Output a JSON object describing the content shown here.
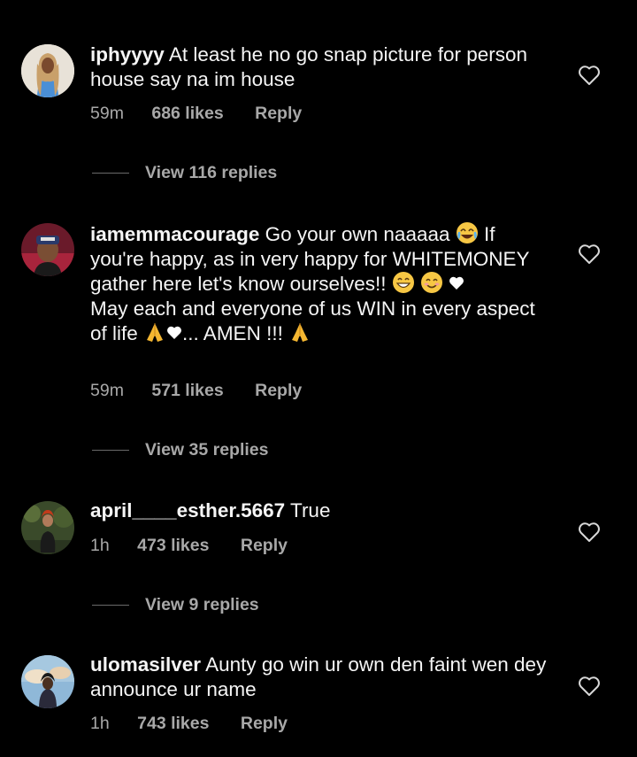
{
  "comments": [
    {
      "username": "iphyyyy",
      "text_parts": [
        "At least he no go snap picture for person house say na im house"
      ],
      "time": "59m",
      "likes": "686 likes",
      "reply": "Reply",
      "view_replies": "View 116 replies"
    },
    {
      "username": "iamemmacourage",
      "text_parts": [
        "Go your own naaaaa",
        "If you're happy, as in very happy for WHITEMONEY gather here let's know ourselves!!",
        "May each and everyone of us WIN in every aspect of life",
        "... AMEN !!!"
      ],
      "time": "59m",
      "likes": "571 likes",
      "reply": "Reply",
      "view_replies": "View 35 replies"
    },
    {
      "username": "april____esther.5667",
      "text_parts": [
        "True"
      ],
      "time": "1h",
      "likes": "473 likes",
      "reply": "Reply",
      "view_replies": "View 9 replies"
    },
    {
      "username": "ulomasilver",
      "text_parts": [
        "Aunty go win ur own den faint wen dey announce ur name"
      ],
      "time": "1h",
      "likes": "743 likes",
      "reply": "Reply"
    }
  ],
  "icons": {
    "like": "heart-outline-icon",
    "emoji_laugh": "face-with-tears-of-joy",
    "emoji_grin": "grinning-face",
    "emoji_smile": "smiling-face",
    "emoji_heart": "white-heart",
    "emoji_pray": "folded-hands"
  },
  "colors": {
    "background": "#000000",
    "text": "#f5f5f5",
    "secondary": "#a8a8a8"
  }
}
